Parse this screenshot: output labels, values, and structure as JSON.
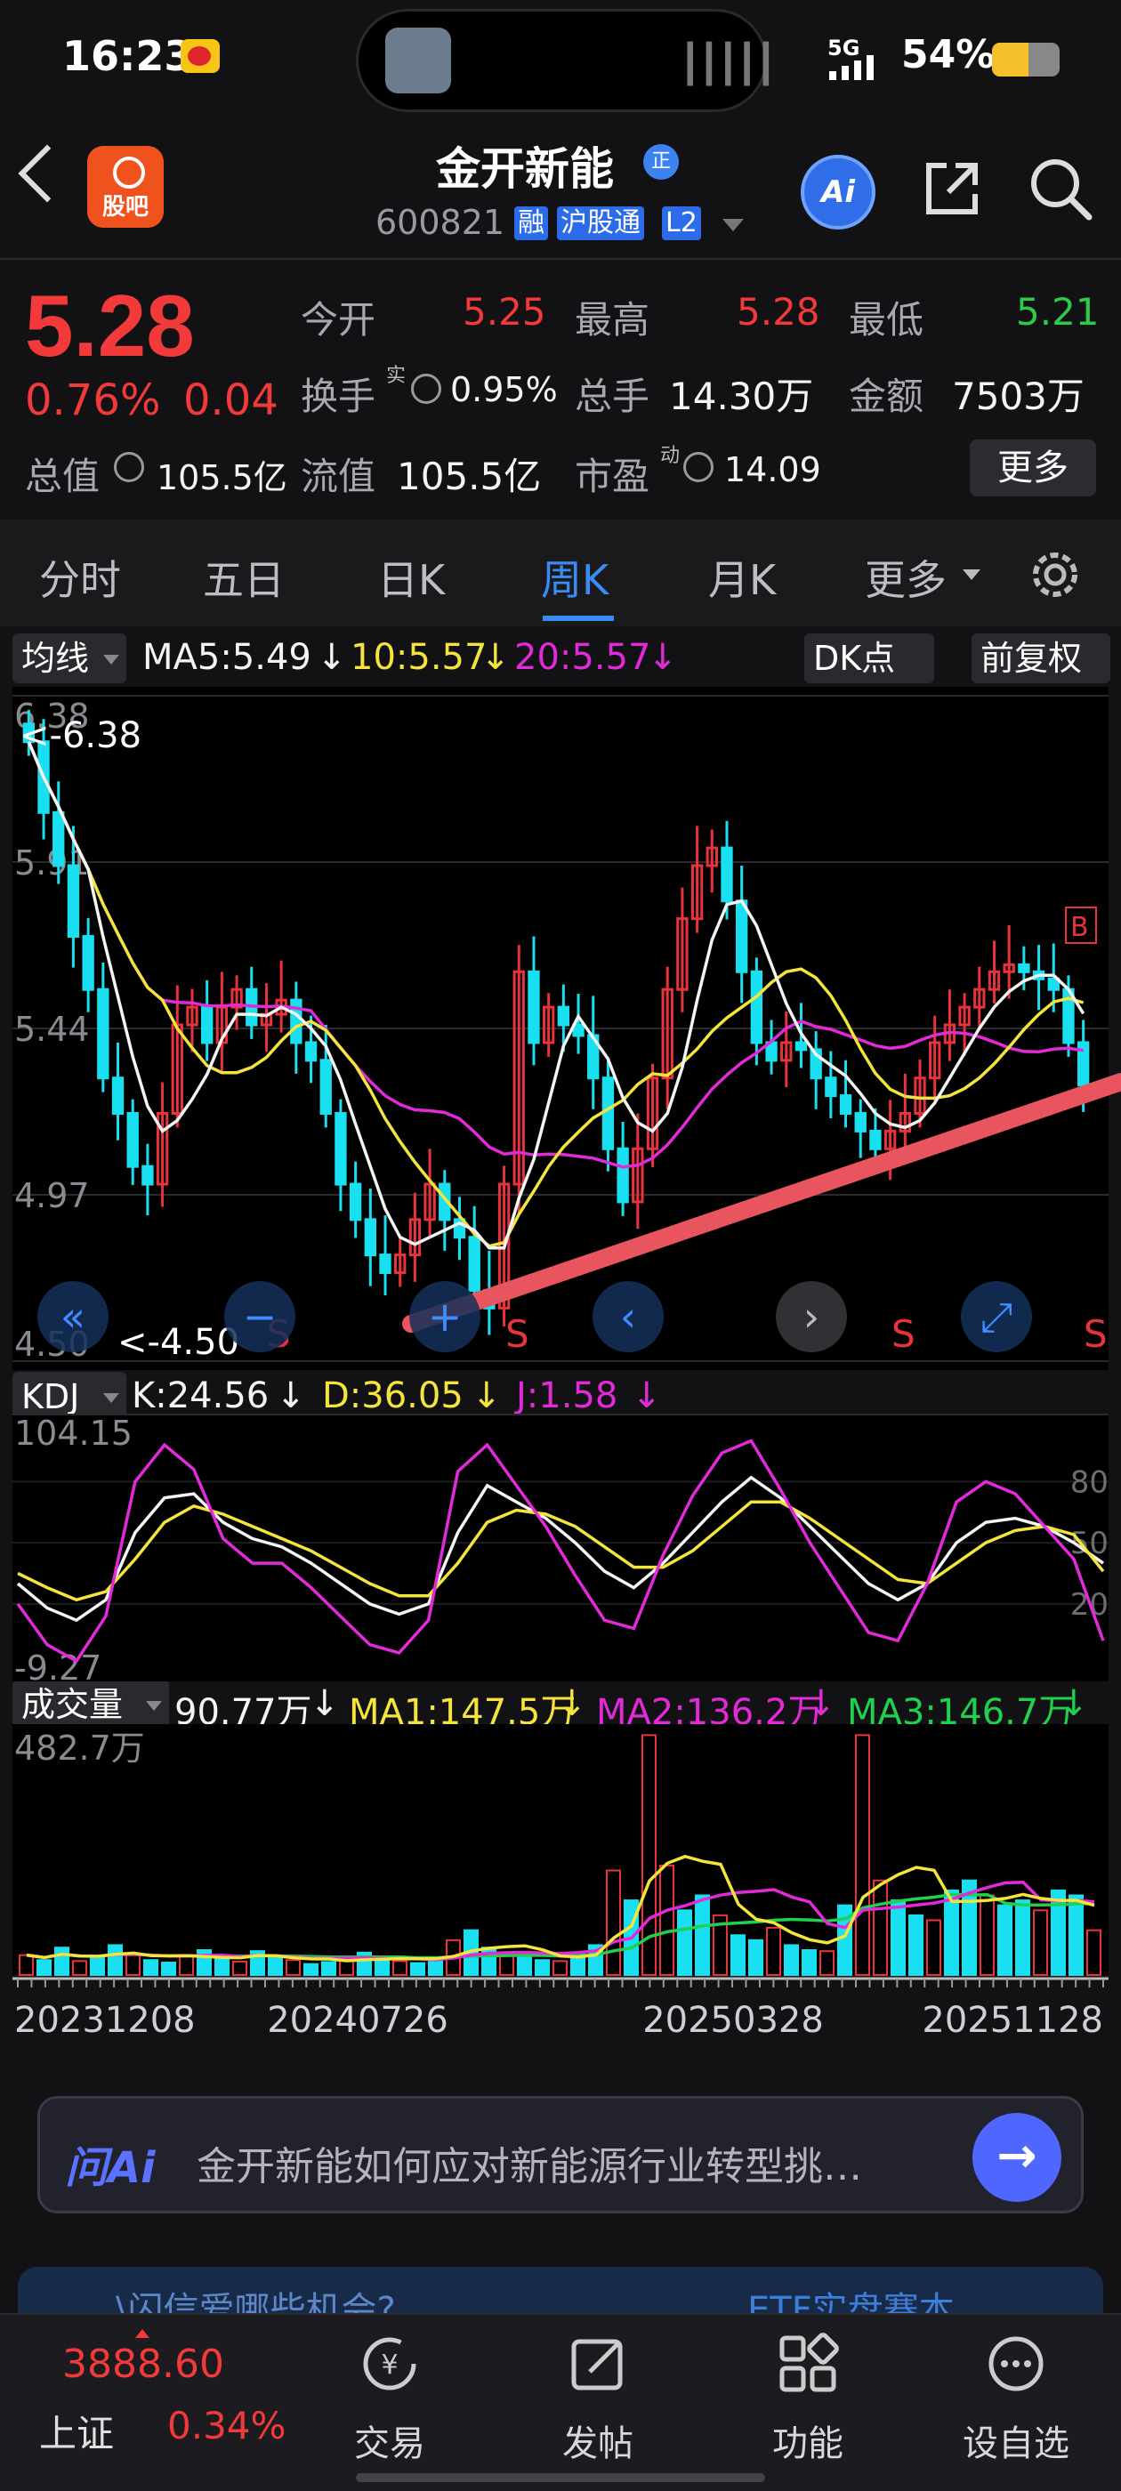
{
  "status_bar": {
    "time": "16:23",
    "network": "5G",
    "battery_text": "54%",
    "battery_level": 0.54
  },
  "header": {
    "guba_label": "股吧",
    "stock_name": "金开新能",
    "zheng_badge": "正",
    "stock_code": "600821",
    "tags": [
      "融",
      "沪股通",
      "L2"
    ],
    "ai_label": "Ai"
  },
  "quote": {
    "price": "5.28",
    "change_pct": "0.76%",
    "change": "0.04",
    "open_label": "今开",
    "open": "5.25",
    "high_label": "最高",
    "high": "5.28",
    "low_label": "最低",
    "low": "5.21",
    "turnover_label": "换手",
    "turnover_mark": "实",
    "turnover": "0.95%",
    "volume_label": "总手",
    "volume": "14.30万",
    "amount_label": "金额",
    "amount": "7503万",
    "total_cap_label": "总值",
    "total_cap": "105.5亿",
    "float_cap_label": "流值",
    "float_cap": "105.5亿",
    "pe_label": "市盈",
    "pe_mark": "动",
    "pe": "14.09",
    "more_button": "更多"
  },
  "tabs": [
    {
      "label": "分时"
    },
    {
      "label": "五日"
    },
    {
      "label": "日K"
    },
    {
      "label": "周K",
      "active": true
    },
    {
      "label": "月K"
    },
    {
      "label": "更多"
    }
  ],
  "kline_legend": {
    "selector": "均线",
    "ma5": "MA5:5.49",
    "ma10": "10:5.57",
    "ma20": "20:5.57",
    "dk_button": "DK点",
    "adjust_button": "前复权"
  },
  "kdj_legend": {
    "selector": "KDJ",
    "k": "K:24.56",
    "d": "D:36.05",
    "j": "J:1.58"
  },
  "volume_legend": {
    "selector": "成交量",
    "vol": "90.77万",
    "ma1": "MA1:147.5万",
    "ma2": "MA2:136.2万",
    "ma3": "MA3:146.7万"
  },
  "chart_data": [
    {
      "type": "candlestick",
      "name": "周K",
      "y_ticks": [
        "6.38",
        "5.91",
        "5.44",
        "4.97",
        "4.50"
      ],
      "ylim": [
        4.5,
        6.38
      ],
      "max_label": "<-6.38",
      "min_label": "<-4.50",
      "marker_letter": "S",
      "marker_rise_letter": "B",
      "x_labels": [
        "20231208",
        "20240726",
        "20250328",
        "20251128"
      ],
      "closes": [
        6.25,
        6.05,
        5.9,
        5.7,
        5.55,
        5.3,
        5.2,
        5.05,
        5.0,
        5.2,
        5.45,
        5.5,
        5.4,
        5.5,
        5.55,
        5.45,
        5.48,
        5.52,
        5.4,
        5.35,
        5.2,
        5.0,
        4.9,
        4.8,
        4.75,
        4.8,
        4.9,
        5.0,
        4.9,
        4.85,
        4.7,
        4.65,
        5.0,
        5.6,
        5.4,
        5.5,
        5.45,
        5.42,
        5.3,
        5.1,
        4.95,
        5.1,
        5.3,
        5.55,
        5.75,
        5.9,
        5.95,
        5.8,
        5.6,
        5.4,
        5.35,
        5.4,
        5.38,
        5.3,
        5.25,
        5.2,
        5.15,
        5.1,
        5.15,
        5.2,
        5.3,
        5.4,
        5.45,
        5.5,
        5.55,
        5.6,
        5.62,
        5.6,
        5.58,
        5.55,
        5.4,
        5.28
      ],
      "ma5_color": "#f4f4f4",
      "ma10_color": "#f5e43c",
      "ma20_color": "#e22ad8"
    },
    {
      "type": "line",
      "name": "KDJ",
      "y_ticks": [
        "104.15",
        "-9.27"
      ],
      "right_ticks": [
        "80",
        "50",
        "20"
      ],
      "ylim": [
        -9.27,
        104.15
      ],
      "series": [
        {
          "name": "K",
          "color": "#f4f4f4",
          "values": [
            30,
            18,
            12,
            22,
            55,
            72,
            74,
            60,
            52,
            48,
            40,
            30,
            20,
            15,
            20,
            55,
            78,
            70,
            62,
            50,
            36,
            28,
            40,
            55,
            70,
            82,
            72,
            58,
            44,
            30,
            22,
            30,
            50,
            60,
            62,
            58,
            50,
            40
          ]
        },
        {
          "name": "D",
          "color": "#f5e43c",
          "values": [
            35,
            28,
            22,
            26,
            42,
            60,
            68,
            64,
            58,
            52,
            46,
            38,
            30,
            24,
            24,
            40,
            60,
            66,
            64,
            58,
            48,
            38,
            38,
            46,
            58,
            70,
            70,
            62,
            52,
            42,
            32,
            30,
            40,
            50,
            56,
            58,
            54,
            36
          ]
        },
        {
          "name": "J",
          "color": "#e22ad8",
          "values": [
            20,
            0,
            -8,
            14,
            80,
            98,
            86,
            52,
            40,
            40,
            28,
            14,
            0,
            -4,
            12,
            85,
            98,
            78,
            58,
            34,
            12,
            8,
            44,
            73,
            94,
            100,
            76,
            50,
            28,
            6,
            2,
            30,
            70,
            80,
            74,
            58,
            42,
            2
          ]
        }
      ]
    },
    {
      "type": "bar",
      "name": "成交量",
      "y_ticks": [
        "482.7万"
      ],
      "ylim": [
        0,
        482.7
      ],
      "values": [
        40,
        30,
        55,
        28,
        35,
        60,
        42,
        30,
        25,
        38,
        50,
        33,
        27,
        48,
        35,
        30,
        22,
        26,
        30,
        45,
        36,
        28,
        24,
        30,
        70,
        90,
        55,
        40,
        38,
        30,
        28,
        45,
        60,
        210,
        150,
        482,
        220,
        130,
        160,
        120,
        80,
        70,
        95,
        60,
        50,
        48,
        140,
        482,
        190,
        150,
        120,
        110,
        170,
        190,
        160,
        140,
        150,
        130,
        170,
        160,
        90
      ],
      "ma1_color": "#f5e43c",
      "ma2_color": "#e22ad8",
      "ma3_color": "#1fd14c"
    }
  ],
  "ask_ai": {
    "logo": "问Ai",
    "question": "金开新能如何应对新能源行业转型挑…"
  },
  "banner": {
    "left_text": "\\闪信爱哪些机会?",
    "right_text": "ETF实盘赛本"
  },
  "bottom_nav": {
    "index_value": "3888.60",
    "index_name": "上证",
    "index_pct": "0.34%",
    "items": [
      "交易",
      "发帖",
      "功能",
      "设自选"
    ]
  }
}
